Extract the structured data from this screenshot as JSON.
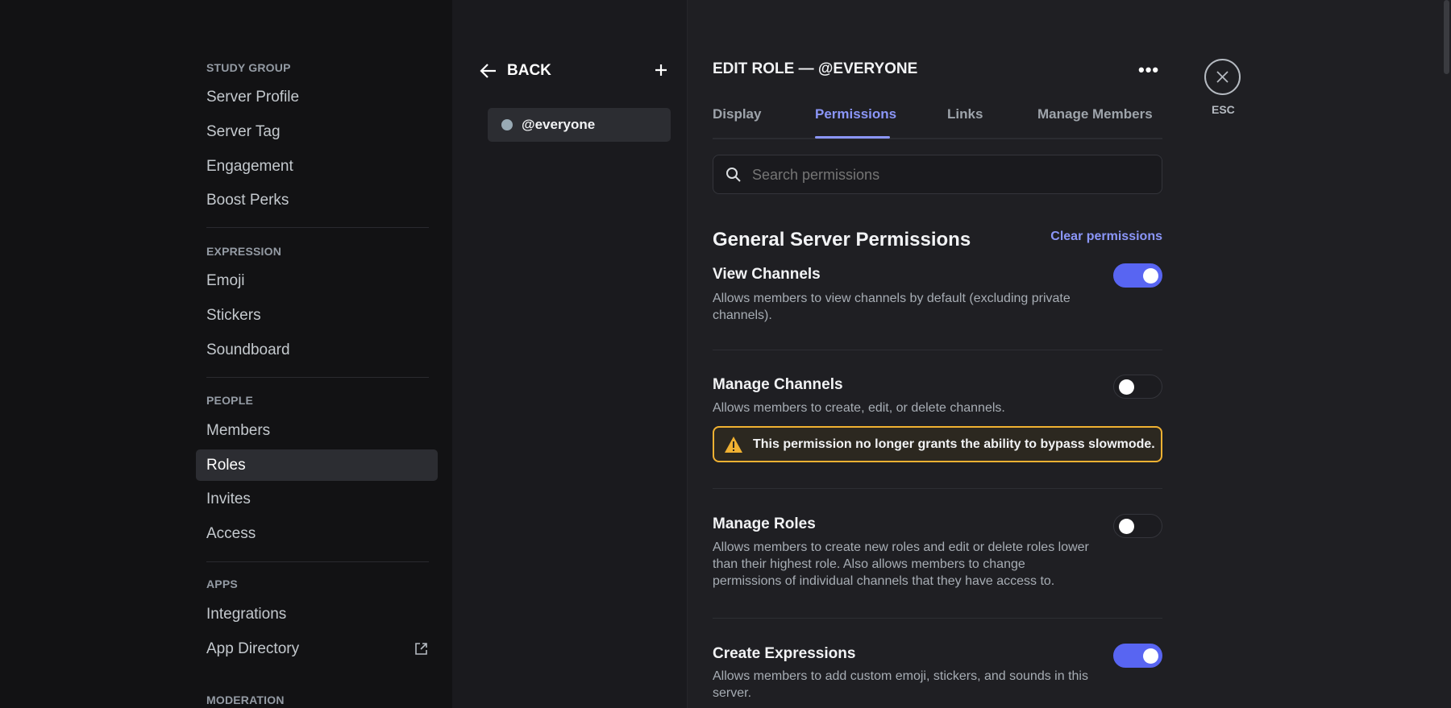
{
  "sidebar": {
    "sections": [
      {
        "title": "STUDY GROUP",
        "items": [
          "Server Profile",
          "Server Tag",
          "Engagement",
          "Boost Perks"
        ]
      },
      {
        "title": "EXPRESSION",
        "items": [
          "Emoji",
          "Stickers",
          "Soundboard"
        ]
      },
      {
        "title": "PEOPLE",
        "items": [
          "Members",
          "Roles",
          "Invites",
          "Access"
        ]
      },
      {
        "title": "APPS",
        "items": [
          "Integrations",
          "App Directory"
        ]
      },
      {
        "title": "MODERATION",
        "items": []
      }
    ],
    "active": "Roles"
  },
  "roles": {
    "back_label": "BACK",
    "items": [
      {
        "name": "@everyone",
        "color": "#99aab5"
      }
    ]
  },
  "editor": {
    "title": "EDIT ROLE — @EVERYONE",
    "esc_label": "ESC",
    "tabs": [
      "Display",
      "Permissions",
      "Links",
      "Manage Members"
    ],
    "active_tab": "Permissions",
    "search_placeholder": "Search permissions",
    "section_title": "General Server Permissions",
    "clear_label": "Clear permissions",
    "permissions": [
      {
        "name": "View Channels",
        "desc": "Allows members to view channels by default (excluding private channels).",
        "enabled": true
      },
      {
        "name": "Manage Channels",
        "desc": "Allows members to create, edit, or delete channels.",
        "enabled": false,
        "warning": "This permission no longer grants the ability to bypass slowmode."
      },
      {
        "name": "Manage Roles",
        "desc": "Allows members to create new roles and edit or delete roles lower than their highest role. Also allows members to change permissions of individual channels that they have access to.",
        "enabled": false
      },
      {
        "name": "Create Expressions",
        "desc": "Allows members to add custom emoji, stickers, and sounds in this server.",
        "enabled": true
      }
    ]
  },
  "colors": {
    "accent": "#5865f2",
    "warning": "#f0b132"
  }
}
